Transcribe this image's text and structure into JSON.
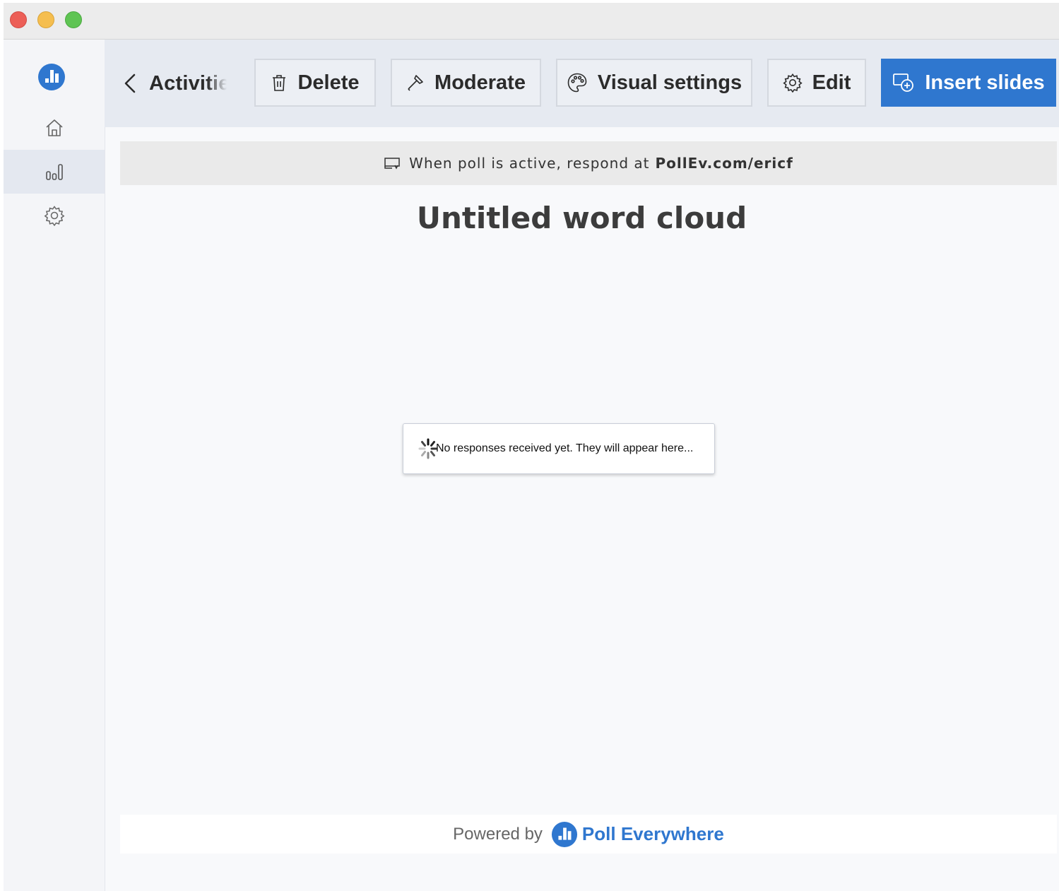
{
  "window": {
    "controls": [
      "close",
      "minimize",
      "zoom"
    ]
  },
  "sidebar": {
    "logo_icon": "poll-everywhere-logo",
    "items": [
      {
        "name": "home",
        "icon": "home-icon",
        "active": false
      },
      {
        "name": "activities",
        "icon": "bar-chart-icon",
        "active": true
      },
      {
        "name": "settings",
        "icon": "gear-icon",
        "active": false
      }
    ]
  },
  "toolbar": {
    "back_label": "Activitie",
    "delete_label": "Delete",
    "moderate_label": "Moderate",
    "visual_settings_label": "Visual settings",
    "edit_label": "Edit",
    "insert_slides_label": "Insert slides"
  },
  "banner": {
    "text": "When poll is active, respond at",
    "url": "PollEv.com/ericf"
  },
  "activity": {
    "title": "Untitled word cloud",
    "empty_message": "No responses received yet. They will appear here..."
  },
  "footer": {
    "powered_by": "Powered by",
    "brand": "Poll Everywhere"
  },
  "colors": {
    "accent": "#2f77cf",
    "toolbar_bg": "#e6eaf1",
    "banner_bg": "#eaeaea"
  }
}
